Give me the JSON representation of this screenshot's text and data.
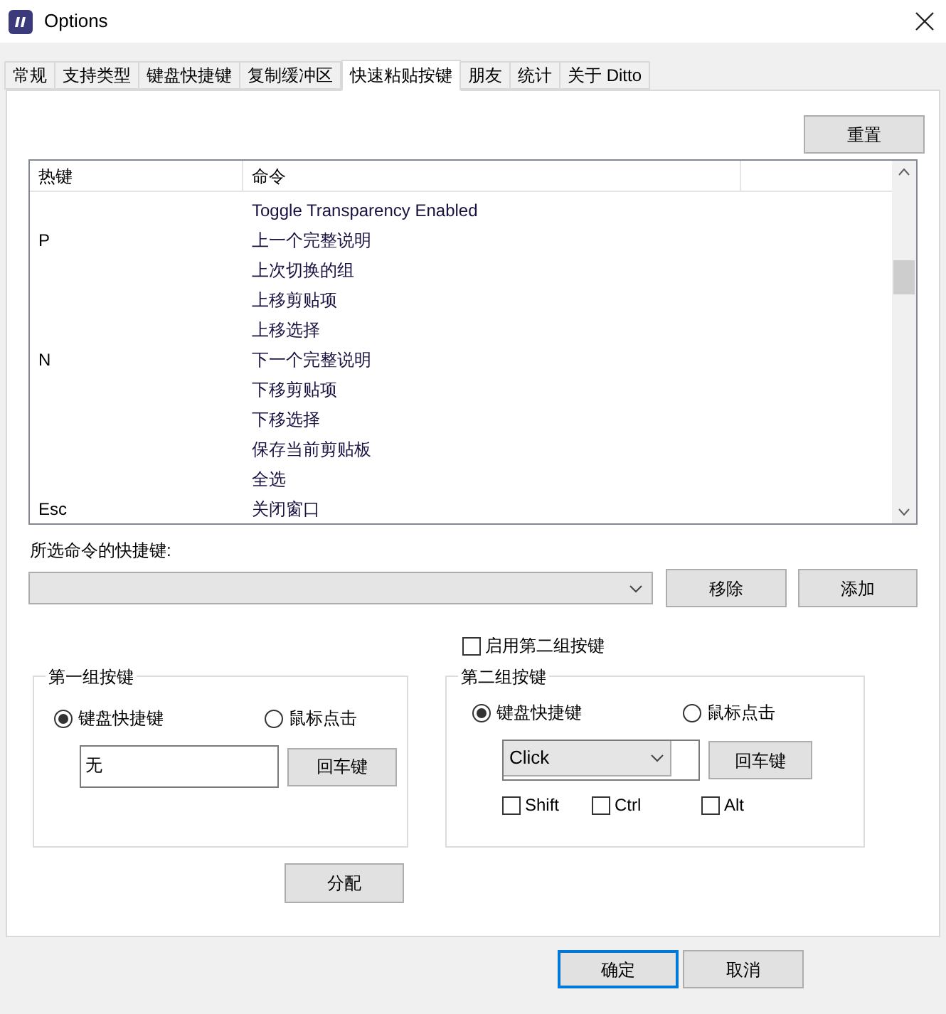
{
  "window": {
    "title": "Options"
  },
  "tabs": [
    {
      "label": "常规",
      "selected": false
    },
    {
      "label": "支持类型",
      "selected": false
    },
    {
      "label": "键盘快捷键",
      "selected": false
    },
    {
      "label": "复制缓冲区",
      "selected": false
    },
    {
      "label": "快速粘贴按键",
      "selected": true
    },
    {
      "label": "朋友",
      "selected": false
    },
    {
      "label": "统计",
      "selected": false
    },
    {
      "label": "关于 Ditto",
      "selected": false
    }
  ],
  "reset_button": "重置",
  "table": {
    "columns": [
      "热键",
      "命令"
    ],
    "rows": [
      {
        "hotkey": "",
        "command": "Toggle Transparency Enabled"
      },
      {
        "hotkey": "P",
        "command": "上一个完整说明"
      },
      {
        "hotkey": "",
        "command": "上次切换的组"
      },
      {
        "hotkey": "",
        "command": "上移剪贴项"
      },
      {
        "hotkey": "",
        "command": "上移选择"
      },
      {
        "hotkey": "N",
        "command": "下一个完整说明"
      },
      {
        "hotkey": "",
        "command": "下移剪贴项"
      },
      {
        "hotkey": "",
        "command": "下移选择"
      },
      {
        "hotkey": "",
        "command": "保存当前剪贴板"
      },
      {
        "hotkey": "",
        "command": "全选"
      },
      {
        "hotkey": "Esc",
        "command": "关闭窗口"
      }
    ]
  },
  "shortcut_label": "所选命令的快捷键:",
  "remove_button": "移除",
  "add_button": "添加",
  "enable_second_group": {
    "label": "启用第二组按键",
    "checked": false
  },
  "group1": {
    "title": "第一组按键",
    "options": [
      {
        "label": "键盘快捷键",
        "selected": true
      },
      {
        "label": "鼠标点击",
        "selected": false
      }
    ],
    "value": "无",
    "enter_button": "回车键"
  },
  "group2": {
    "title": "第二组按键",
    "options": [
      {
        "label": "键盘快捷键",
        "selected": true
      },
      {
        "label": "鼠标点击",
        "selected": false
      }
    ],
    "dropdown": "Click",
    "enter_button": "回车键",
    "modifiers": [
      {
        "label": "Shift",
        "checked": false
      },
      {
        "label": "Ctrl",
        "checked": false
      },
      {
        "label": "Alt",
        "checked": false
      }
    ]
  },
  "assign_button": "分配",
  "ok_button": "确定",
  "cancel_button": "取消"
}
